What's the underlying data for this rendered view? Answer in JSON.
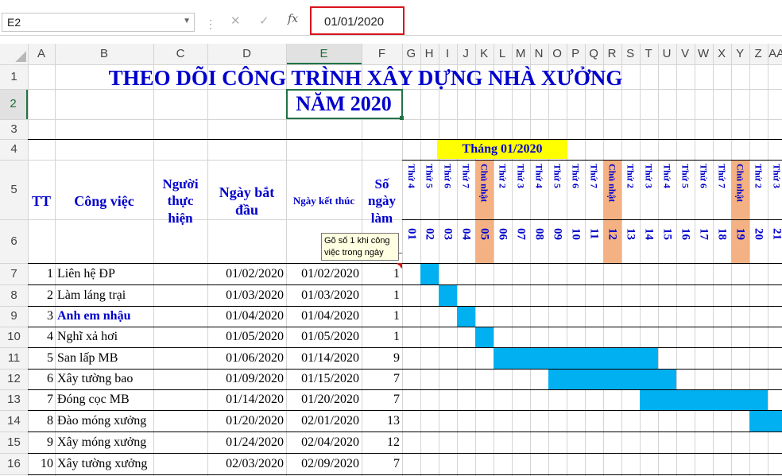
{
  "formula_bar": {
    "name_box": "E2",
    "cancel_icon": "✕",
    "enter_icon": "✓",
    "fx_label": "fx",
    "formula_value": "01/01/2020"
  },
  "columns": [
    "A",
    "B",
    "C",
    "D",
    "E",
    "F",
    "G",
    "H",
    "I",
    "J",
    "K",
    "L",
    "M",
    "N",
    "O",
    "P",
    "Q",
    "R",
    "S",
    "T",
    "U",
    "V",
    "W",
    "X",
    "Y",
    "Z",
    "AA"
  ],
  "rows": [
    "1",
    "2",
    "3",
    "4",
    "5",
    "6",
    "7",
    "8",
    "9",
    "10",
    "11",
    "12",
    "13",
    "14",
    "15",
    "16"
  ],
  "selected_column": "E",
  "selected_row": "2",
  "sheet": {
    "title": "THEO DÕI CÔNG TRÌNH XÂY DỰNG NHÀ XƯỞNG",
    "year": "NĂM 2020",
    "month_label": "Tháng 01/2020",
    "headers": {
      "tt": "TT",
      "task": "Công việc",
      "owner": "Người thực hiện",
      "start": "Ngày bắt đầu",
      "end": "Ngày kết thúc",
      "days": "Số ngày làm"
    },
    "timeline": [
      {
        "day": "Thứ 4",
        "date": "01"
      },
      {
        "day": "Thứ 5",
        "date": "02"
      },
      {
        "day": "Thứ 6",
        "date": "03"
      },
      {
        "day": "Thứ 7",
        "date": "04"
      },
      {
        "day": "Chủ nhật",
        "date": "05"
      },
      {
        "day": "Thứ 2",
        "date": "06"
      },
      {
        "day": "Thứ 3",
        "date": "07"
      },
      {
        "day": "Thứ 4",
        "date": "08"
      },
      {
        "day": "Thứ 5",
        "date": "09"
      },
      {
        "day": "Thứ 6",
        "date": "10"
      },
      {
        "day": "Thứ 7",
        "date": "11"
      },
      {
        "day": "Chủ nhật",
        "date": "12"
      },
      {
        "day": "Thứ 2",
        "date": "13"
      },
      {
        "day": "Thứ 3",
        "date": "14"
      },
      {
        "day": "Thứ 4",
        "date": "15"
      },
      {
        "day": "Thứ 5",
        "date": "16"
      },
      {
        "day": "Thứ 6",
        "date": "17"
      },
      {
        "day": "Thứ 7",
        "date": "18"
      },
      {
        "day": "Chủ nhật",
        "date": "19"
      },
      {
        "day": "Thứ 2",
        "date": "20"
      },
      {
        "day": "Thứ 3",
        "date": "21"
      }
    ],
    "tasks": [
      {
        "tt": "1",
        "name": "Liên hệ ĐP",
        "start": "01/02/2020",
        "end": "01/02/2020",
        "days": "1",
        "bold": false
      },
      {
        "tt": "2",
        "name": "Làm láng trại",
        "start": "01/03/2020",
        "end": "01/03/2020",
        "days": "1",
        "bold": false
      },
      {
        "tt": "3",
        "name": "Anh em nhậu",
        "start": "01/04/2020",
        "end": "01/04/2020",
        "days": "1",
        "bold": true
      },
      {
        "tt": "4",
        "name": "Nghĩ xả hơi",
        "start": "01/05/2020",
        "end": "01/05/2020",
        "days": "1",
        "bold": false
      },
      {
        "tt": "5",
        "name": "San lấp MB",
        "start": "01/06/2020",
        "end": "01/14/2020",
        "days": "9",
        "bold": false
      },
      {
        "tt": "6",
        "name": "Xây tường bao",
        "start": "01/09/2020",
        "end": "01/15/2020",
        "days": "7",
        "bold": false
      },
      {
        "tt": "7",
        "name": "Đóng cọc MB",
        "start": "01/14/2020",
        "end": "01/20/2020",
        "days": "7",
        "bold": false
      },
      {
        "tt": "8",
        "name": "Đào móng xưởng",
        "start": "01/20/2020",
        "end": "02/01/2020",
        "days": "13",
        "bold": false
      },
      {
        "tt": "9",
        "name": "Xây móng xưởng",
        "start": "01/24/2020",
        "end": "02/04/2020",
        "days": "12",
        "bold": false
      },
      {
        "tt": "10",
        "name": "Xây tường xưởng",
        "start": "02/03/2020",
        "end": "02/09/2020",
        "days": "7",
        "bold": false
      }
    ],
    "tooltip": "Gõ số 1 khi công việc trong ngày"
  },
  "colors": {
    "title_blue": "#0000cc",
    "gantt_fill": "#00b0f0",
    "month_fill": "#ffff00",
    "sunday_fill": "#f4b183",
    "selection_green": "#217346",
    "highlight_red": "#d9141c"
  }
}
